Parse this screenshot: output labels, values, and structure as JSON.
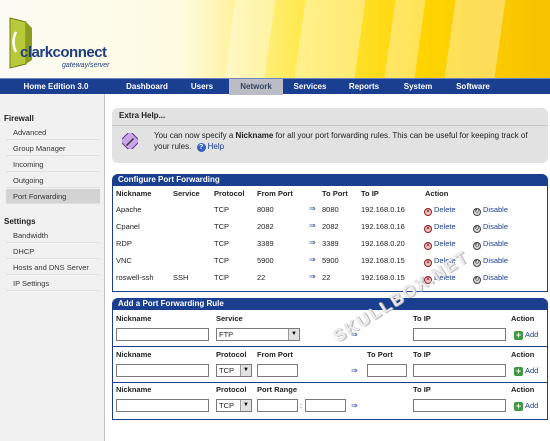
{
  "header": {
    "logo_word": "clarkconnect",
    "logo_sub": "gateway/server",
    "colors": {
      "brand": "#1a3f91",
      "accent": "#ffd400"
    }
  },
  "nav": {
    "edition": "Home Edition 3.0",
    "tabs": [
      {
        "label": "Dashboard",
        "active": false
      },
      {
        "label": "Users",
        "active": false
      },
      {
        "label": "Network",
        "active": true
      },
      {
        "label": "Services",
        "active": false
      },
      {
        "label": "Reports",
        "active": false
      },
      {
        "label": "System",
        "active": false
      },
      {
        "label": "Software",
        "active": false
      }
    ]
  },
  "sidebar": {
    "firewall_head": "Firewall",
    "firewall_items": [
      "Advanced",
      "Group Manager",
      "Incoming",
      "Outgoing",
      "Port Forwarding"
    ],
    "active_item": "Port Forwarding",
    "settings_head": "Settings",
    "settings_items": [
      "Bandwidth",
      "DHCP",
      "Hosts and DNS Server",
      "IP Settings"
    ]
  },
  "help": {
    "title": "Extra Help...",
    "msg_pre": "You can now specify a ",
    "msg_bold": "Nickname",
    "msg_post": " for all your port forwarding rules.  This can be useful for keeping track of your rules.",
    "link": "Help"
  },
  "configure": {
    "title": "Configure Port Forwarding",
    "columns": [
      "Nickname",
      "Service",
      "Protocol",
      "From Port",
      "To Port",
      "To IP",
      "Action"
    ],
    "rows": [
      {
        "nickname": "Apache",
        "service": "",
        "protocol": "TCP",
        "from_port": "8080",
        "to_port": "8080",
        "to_ip": "192.168.0.16"
      },
      {
        "nickname": "Cpanel",
        "service": "",
        "protocol": "TCP",
        "from_port": "2082",
        "to_port": "2082",
        "to_ip": "192.168.0.16"
      },
      {
        "nickname": "RDP",
        "service": "",
        "protocol": "TCP",
        "from_port": "3389",
        "to_port": "3389",
        "to_ip": "192.168.0.20"
      },
      {
        "nickname": "VNC",
        "service": "",
        "protocol": "TCP",
        "from_port": "5900",
        "to_port": "5900",
        "to_ip": "192.168.0.15"
      },
      {
        "nickname": "roswell-ssh",
        "service": "SSH",
        "protocol": "TCP",
        "from_port": "22",
        "to_port": "22",
        "to_ip": "192.168.0.15"
      }
    ],
    "delete_label": "Delete",
    "disable_label": "Disable",
    "arrow": "⇒"
  },
  "add_rule": {
    "title": "Add a Port Forwarding Rule",
    "section1": {
      "nickname": "Nickname",
      "service": "Service",
      "to_ip": "To IP",
      "action": "Action",
      "service_value": "FTP"
    },
    "section2": {
      "nickname": "Nickname",
      "protocol": "Protocol",
      "from_port": "From Port",
      "to_port": "To Port",
      "to_ip": "To IP",
      "action": "Action",
      "protocol_value": "TCP"
    },
    "section3": {
      "nickname": "Nickname",
      "protocol": "Protocol",
      "port_range": "Port Range",
      "to_ip": "To IP",
      "action": "Action",
      "protocol_value": "TCP",
      "range_sep": ":"
    },
    "add_label": "Add"
  },
  "watermark": "SKULLBOX.NET"
}
